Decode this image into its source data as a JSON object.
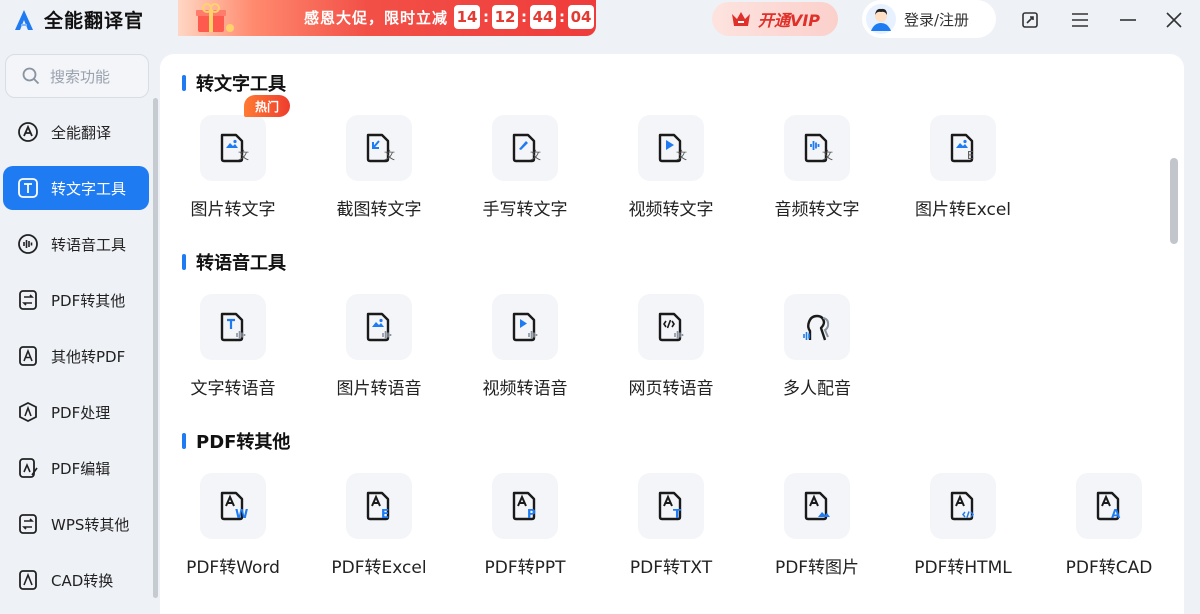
{
  "app": {
    "title": "全能翻译官"
  },
  "promo": {
    "text": "感恩大促，限时立减",
    "countdown": [
      "14",
      "12",
      "44",
      "04"
    ]
  },
  "header": {
    "vip_label": "开通VIP",
    "login_label": "登录/注册"
  },
  "search": {
    "placeholder": "搜索功能"
  },
  "sidebar": {
    "items": [
      {
        "label": "全能翻译",
        "icon": "translate-icon",
        "active": false
      },
      {
        "label": "转文字工具",
        "icon": "text-t-icon",
        "active": true
      },
      {
        "label": "转语音工具",
        "icon": "sound-wave-icon",
        "active": false
      },
      {
        "label": "PDF转其他",
        "icon": "swap-doc-icon",
        "active": false
      },
      {
        "label": "其他转PDF",
        "icon": "pdf-a-icon",
        "active": false
      },
      {
        "label": "PDF处理",
        "icon": "pdf-process-icon",
        "active": false
      },
      {
        "label": "PDF编辑",
        "icon": "pdf-edit-icon",
        "active": false
      },
      {
        "label": "WPS转其他",
        "icon": "swap-doc-icon",
        "active": false
      },
      {
        "label": "CAD转换",
        "icon": "cad-icon",
        "active": false
      }
    ]
  },
  "sections": [
    {
      "title": "转文字工具",
      "tools": [
        {
          "label": "图片转文字",
          "icon": "image-to-text-icon",
          "badge": "热门"
        },
        {
          "label": "截图转文字",
          "icon": "screenshot-to-text-icon"
        },
        {
          "label": "手写转文字",
          "icon": "handwriting-to-text-icon"
        },
        {
          "label": "视频转文字",
          "icon": "video-to-text-icon"
        },
        {
          "label": "音频转文字",
          "icon": "audio-to-text-icon"
        },
        {
          "label": "图片转Excel",
          "icon": "image-to-excel-icon"
        }
      ]
    },
    {
      "title": "转语音工具",
      "tools": [
        {
          "label": "文字转语音",
          "icon": "text-to-speech-icon"
        },
        {
          "label": "图片转语音",
          "icon": "image-to-speech-icon"
        },
        {
          "label": "视频转语音",
          "icon": "video-to-speech-icon"
        },
        {
          "label": "网页转语音",
          "icon": "webpage-to-speech-icon"
        },
        {
          "label": "多人配音",
          "icon": "multi-voice-icon"
        }
      ]
    },
    {
      "title": "PDF转其他",
      "tools": [
        {
          "label": "PDF转Word",
          "icon": "pdf-to-word-icon"
        },
        {
          "label": "PDF转Excel",
          "icon": "pdf-to-excel-icon"
        },
        {
          "label": "PDF转PPT",
          "icon": "pdf-to-ppt-icon"
        },
        {
          "label": "PDF转TXT",
          "icon": "pdf-to-txt-icon"
        },
        {
          "label": "PDF转图片",
          "icon": "pdf-to-image-icon"
        },
        {
          "label": "PDF转HTML",
          "icon": "pdf-to-html-icon"
        },
        {
          "label": "PDF转CAD",
          "icon": "pdf-to-cad-icon"
        }
      ]
    }
  ],
  "colors": {
    "accent": "#1f7bf2",
    "promo_red": "#ef3b3b",
    "vip_red": "#e0302a"
  }
}
